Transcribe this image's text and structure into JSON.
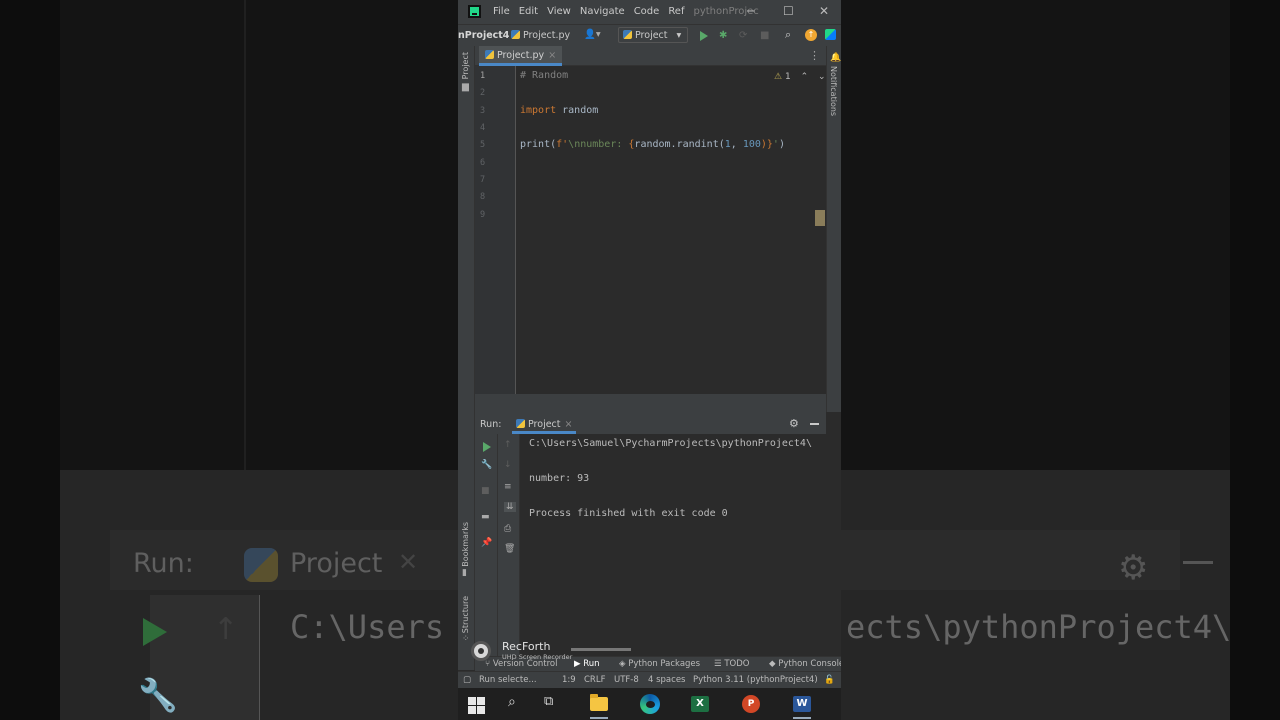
{
  "background": {
    "run_label": "Run:",
    "project_tab": "Project",
    "close_glyph": "✕",
    "path_left": "C:\\Users",
    "path_right": "ects\\pythonProject4\\"
  },
  "titlebar": {
    "menu": [
      "File",
      "Edit",
      "View",
      "Navigate",
      "Code",
      "Ref",
      "pythonProjec"
    ],
    "minimize": "─",
    "maximize": "☐",
    "close": "✕"
  },
  "toolbar": {
    "project_name": "nProject4",
    "file_crumb": "Project.py",
    "user_glyph": "👤▾",
    "run_config": "Project",
    "run_config_arrow": "▾"
  },
  "left_strip": {
    "project_label": "Project",
    "bookmarks_label": "Bookmarks",
    "structure_label": "Structure"
  },
  "right_strip": {
    "notifications_label": "Notifications"
  },
  "editor": {
    "tab_label": "Project.py",
    "tab_close": "×",
    "line_numbers": [
      "1",
      "2",
      "3",
      "4",
      "5",
      "6",
      "7",
      "8",
      "9"
    ],
    "inspection": {
      "warning_glyph": "⚠",
      "count": "1",
      "up": "⌃",
      "down": "⌄"
    },
    "code": {
      "line1_comment": "# Random",
      "line3_kw": "import",
      "line3_rest": " random",
      "line5_print": "print(",
      "line5_fprefix": "f'",
      "line5_str": "\\nnumber: ",
      "line5_open": "{",
      "line5_call": "random.randint(",
      "line5_n1": "1",
      "line5_comma": ", ",
      "line5_n2": "100",
      "line5_close": ")}",
      "line5_end_str": "'",
      "line5_paren": ")"
    }
  },
  "run_panel": {
    "label": "Run:",
    "tab_label": "Project",
    "tab_close": "×",
    "gear": "⚙",
    "output": [
      "C:\\Users\\Samuel\\PycharmProjects\\pythonProject4\\",
      "",
      "number: 93",
      "",
      "Process finished with exit code 0"
    ]
  },
  "bottom_tabs": {
    "version_control": "Version Control",
    "run": "Run",
    "python_packages": "Python Packages",
    "todo": "TODO",
    "python_console": "Python Console"
  },
  "status_bar": {
    "message": "Run selecte...",
    "position": "1:9",
    "line_ending": "CRLF",
    "encoding": "UTF-8",
    "indent": "4 spaces",
    "interpreter": "Python 3.11 (pythonProject4)",
    "lock_glyph": "🔓"
  },
  "watermark": {
    "title": "RecForth",
    "subtitle": "UHD Screen Recorder"
  },
  "taskbar": {
    "excel": "X",
    "powerpoint": "P",
    "word": "W"
  },
  "colors": {
    "accent_tab": "#4a88c7",
    "run_green": "#59a869",
    "keyword": "#cc7832",
    "string": "#6a8759",
    "number": "#6897bb"
  }
}
